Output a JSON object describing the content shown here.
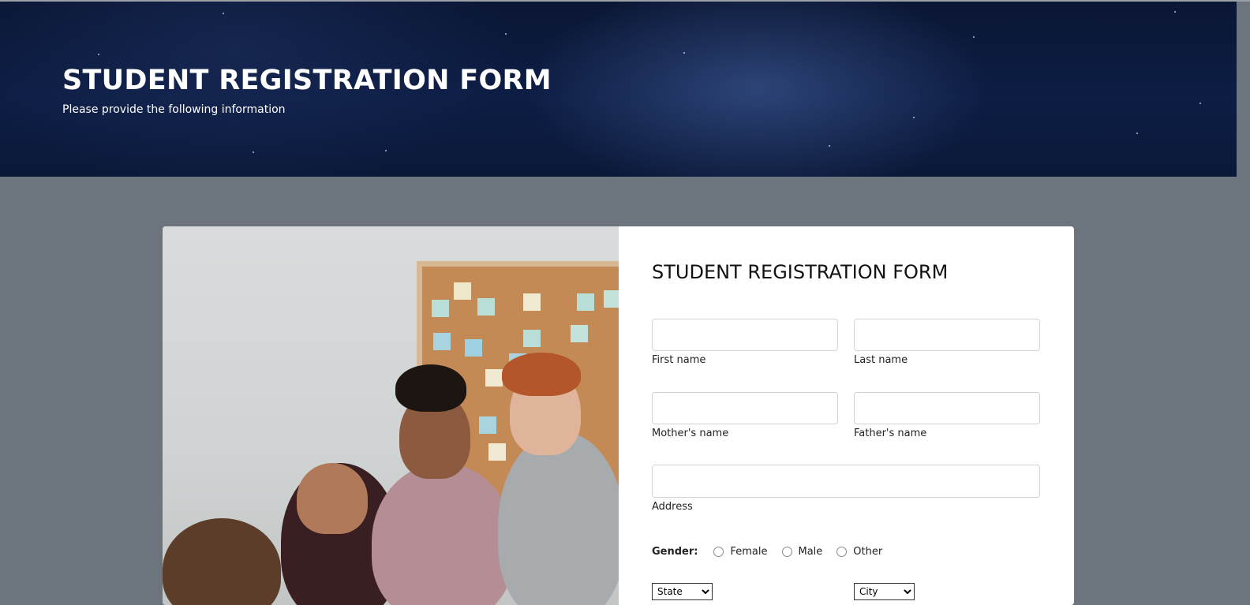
{
  "hero": {
    "title": "STUDENT REGISTRATION FORM",
    "subtitle": "Please provide the following information"
  },
  "form": {
    "title": "STUDENT REGISTRATION FORM",
    "fields": {
      "first_name": {
        "label": "First name",
        "value": ""
      },
      "last_name": {
        "label": "Last name",
        "value": ""
      },
      "mother_name": {
        "label": "Mother's name",
        "value": ""
      },
      "father_name": {
        "label": "Father's name",
        "value": ""
      },
      "address": {
        "label": "Address",
        "value": ""
      }
    },
    "gender": {
      "label": "Gender:",
      "options": [
        "Female",
        "Male",
        "Other"
      ]
    },
    "state": {
      "selected": "State"
    },
    "city": {
      "selected": "City"
    }
  },
  "colors": {
    "page_background": "#6c757d",
    "hero_background": "#0d1d44",
    "card_background": "#ffffff"
  }
}
